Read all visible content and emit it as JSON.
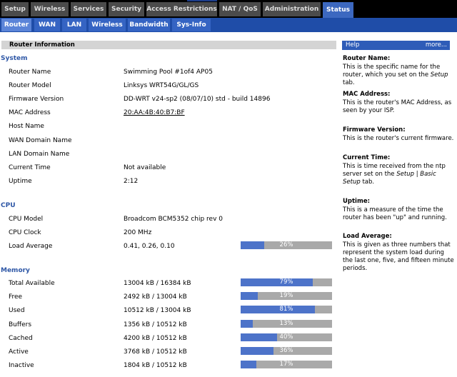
{
  "main_tabs": [
    {
      "label": "Setup"
    },
    {
      "label": "Wireless"
    },
    {
      "label": "Services"
    },
    {
      "label": "Security"
    },
    {
      "label": "Access Restrictions"
    },
    {
      "label": "NAT / QoS"
    },
    {
      "label": "Administration"
    },
    {
      "label": "Status",
      "active": true
    }
  ],
  "sub_tabs": [
    {
      "label": "Router",
      "active": true
    },
    {
      "label": "WAN"
    },
    {
      "label": "LAN"
    },
    {
      "label": "Wireless"
    },
    {
      "label": "Bandwidth"
    },
    {
      "label": "Sys-Info"
    }
  ],
  "page": {
    "section_title": "Router Information",
    "system": {
      "title": "System",
      "rows": [
        {
          "label": "Router Name",
          "value": "Swimming Pool #1of4 AP05"
        },
        {
          "label": "Router Model",
          "value": "Linksys WRT54G/GL/GS"
        },
        {
          "label": "Firmware Version",
          "value": "DD-WRT v24-sp2 (08/07/10) std - build 14896"
        },
        {
          "label": "MAC Address",
          "value": "20:AA:4B:40:B7:BF"
        },
        {
          "label": "Host Name",
          "value": ""
        },
        {
          "label": "WAN Domain Name",
          "value": ""
        },
        {
          "label": "LAN Domain Name",
          "value": ""
        },
        {
          "label": "Current Time",
          "value": "Not available"
        },
        {
          "label": "Uptime",
          "value": "2:12"
        }
      ]
    },
    "cpu": {
      "title": "CPU",
      "rows": [
        {
          "label": "CPU Model",
          "value": "Broadcom BCM5352 chip rev 0"
        },
        {
          "label": "CPU Clock",
          "value": "200 MHz"
        },
        {
          "label": "Load Average",
          "value": "0.41, 0.26, 0.10",
          "percent": 26,
          "percent_label": "26%"
        }
      ]
    },
    "memory": {
      "title": "Memory",
      "rows": [
        {
          "label": "Total Available",
          "value": "13004 kB / 16384 kB",
          "percent": 79,
          "percent_label": "79%"
        },
        {
          "label": "Free",
          "value": "2492 kB / 13004 kB",
          "percent": 19,
          "percent_label": "19%"
        },
        {
          "label": "Used",
          "value": "10512 kB / 13004 kB",
          "percent": 81,
          "percent_label": "81%"
        },
        {
          "label": "Buffers",
          "value": "1356 kB / 10512 kB",
          "percent": 13,
          "percent_label": "13%"
        },
        {
          "label": "Cached",
          "value": "4200 kB / 10512 kB",
          "percent": 40,
          "percent_label": "40%"
        },
        {
          "label": "Active",
          "value": "3768 kB / 10512 kB",
          "percent": 36,
          "percent_label": "36%"
        },
        {
          "label": "Inactive",
          "value": "1804 kB / 10512 kB",
          "percent": 17,
          "percent_label": "17%"
        }
      ]
    }
  },
  "help": {
    "title": "Help",
    "more_label": "more...",
    "items": [
      {
        "title": "Router Name:",
        "text_before": "This is the specific name for the router, which you set on the ",
        "text_em": "Setup",
        "text_after": " tab."
      },
      {
        "title": "MAC Address:",
        "text_before": "This is the router's MAC Address, as seen by your ISP.",
        "text_em": "",
        "text_after": ""
      },
      {
        "title": "Firmware Version:",
        "text_before": "This is the router's current firmware.",
        "text_em": "",
        "text_after": ""
      },
      {
        "title": "Current Time:",
        "text_before": "This is time received from the ntp server set on the ",
        "text_em": "Setup | Basic Setup",
        "text_after": " tab."
      },
      {
        "title": "Uptime:",
        "text_before": "This is a measure of the time the router has been \"up\" and running.",
        "text_em": "",
        "text_after": ""
      },
      {
        "title": "Load Average:",
        "text_before": "This is given as three numbers that represent the system load during the last one, five, and fifteen minute periods.",
        "text_em": "",
        "text_after": ""
      }
    ]
  },
  "colors": {
    "nav_black": "#000000",
    "tab_gray": "#4b4b4b",
    "tab_active": "#3c68c0",
    "sub_bar": "#1f4da8",
    "bar_fill": "#4d73c9",
    "bar_track": "#a9a9a9",
    "group_title": "#2e57a6"
  }
}
